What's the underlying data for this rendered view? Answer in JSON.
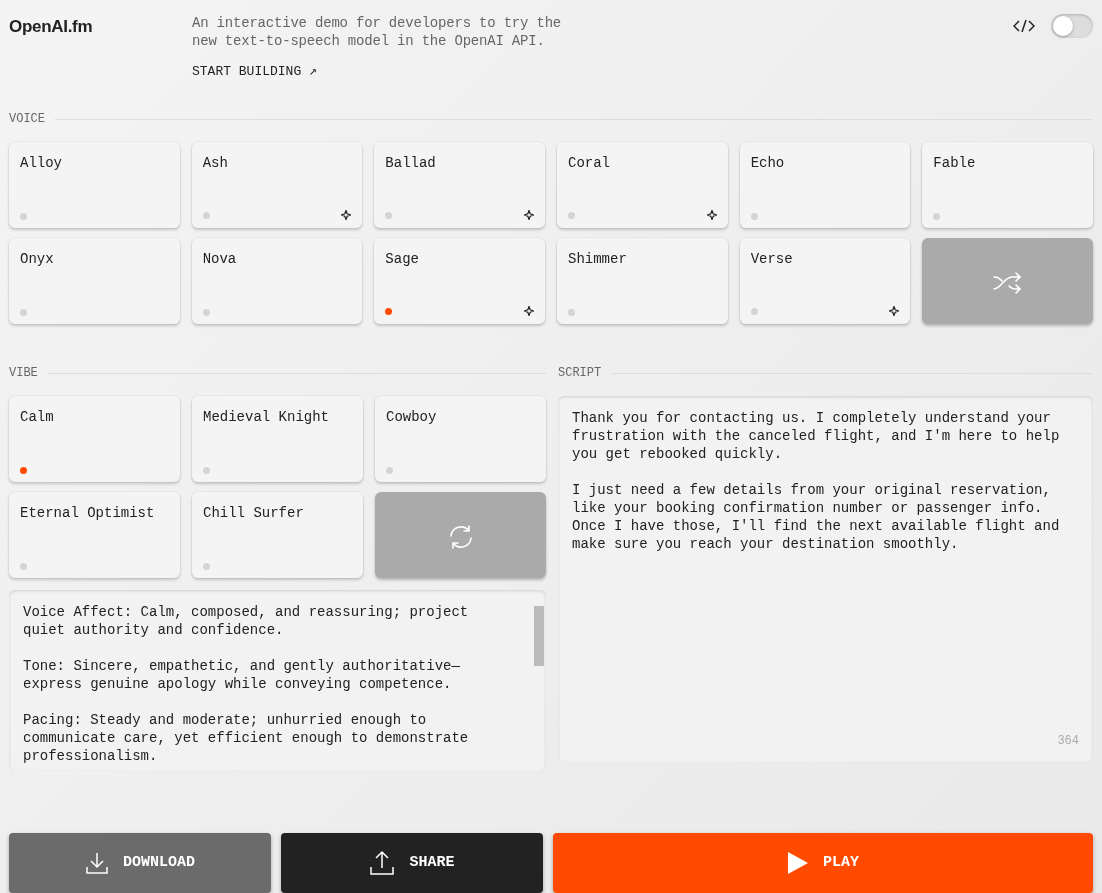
{
  "header": {
    "logo": "OpenAI.fm",
    "description": "An interactive demo for developers to try the new text-to-speech model in the OpenAI API.",
    "link": "START BUILDING ↗",
    "code_toggle": {
      "on": false
    }
  },
  "voice": {
    "label": "VOICE",
    "items": [
      {
        "name": "Alloy",
        "selected": false,
        "featured": false
      },
      {
        "name": "Ash",
        "selected": false,
        "featured": true
      },
      {
        "name": "Ballad",
        "selected": false,
        "featured": true
      },
      {
        "name": "Coral",
        "selected": false,
        "featured": true
      },
      {
        "name": "Echo",
        "selected": false,
        "featured": false
      },
      {
        "name": "Fable",
        "selected": false,
        "featured": false
      },
      {
        "name": "Onyx",
        "selected": false,
        "featured": false
      },
      {
        "name": "Nova",
        "selected": false,
        "featured": false
      },
      {
        "name": "Sage",
        "selected": true,
        "featured": true
      },
      {
        "name": "Shimmer",
        "selected": false,
        "featured": false
      },
      {
        "name": "Verse",
        "selected": false,
        "featured": true
      }
    ]
  },
  "vibe": {
    "label": "VIBE",
    "items": [
      {
        "name": "Calm",
        "selected": true
      },
      {
        "name": "Medieval Knight",
        "selected": false
      },
      {
        "name": "Cowboy",
        "selected": false
      },
      {
        "name": "Eternal Optimist",
        "selected": false
      },
      {
        "name": "Chill Surfer",
        "selected": false
      }
    ],
    "instructions": "Voice Affect: Calm, composed, and reassuring; project quiet authority and confidence.\n\nTone: Sincere, empathetic, and gently authoritative—express genuine apology while conveying competence.\n\nPacing: Steady and moderate; unhurried enough to communicate care, yet efficient enough to demonstrate professionalism."
  },
  "script": {
    "label": "SCRIPT",
    "text": "Thank you for contacting us. I completely understand your frustration with the canceled flight, and I'm here to help you get rebooked quickly.\n\nI just need a few details from your original reservation, like your booking confirmation number or passenger info. Once I have those, I'll find the next available flight and make sure you reach your destination smoothly.",
    "count": "364"
  },
  "actions": {
    "download": "DOWNLOAD",
    "share": "SHARE",
    "play": "PLAY"
  }
}
